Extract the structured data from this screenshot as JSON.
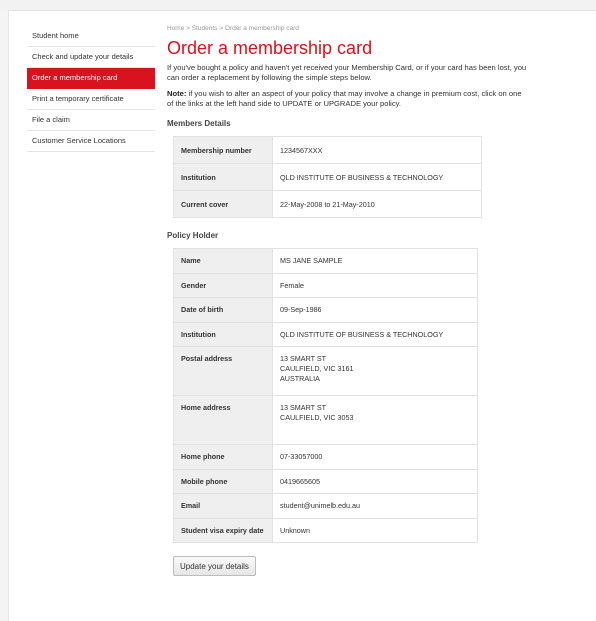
{
  "breadcrumb": {
    "home": "Home",
    "sep1": ">",
    "students": "Students",
    "sep2": ">",
    "current": "Order a membership card"
  },
  "sidebar": {
    "items": [
      {
        "label": "Student home",
        "active": false
      },
      {
        "label": "Check and update your details",
        "active": false
      },
      {
        "label": "Order a membership card",
        "active": true
      },
      {
        "label": "Print a temporary certificate",
        "active": false
      },
      {
        "label": "File a claim",
        "active": false
      },
      {
        "label": "Customer Service Locations",
        "active": false
      }
    ]
  },
  "main": {
    "title": "Order a membership card",
    "intro": "If you've bought a policy and haven't yet received your Membership Card, or if your card has been lost, you can order a replacement by following the simple steps below.",
    "note_label": "Note:",
    "note_text": " if you wish to alter an aspect of your policy that may involve a change in premium cost, click on one of the links at the left hand side to UPDATE or UPGRADE your policy."
  },
  "members": {
    "heading": "Members Details",
    "rows": [
      {
        "label": "Membership number",
        "value": "1234567XXX"
      },
      {
        "label": "Institution",
        "value": "QLD INSTITUTE OF BUSINESS & TECHNOLOGY"
      },
      {
        "label": "Current cover",
        "value": "22-May-2008 to 21-May-2010"
      }
    ]
  },
  "holder": {
    "heading": "Policy Holder",
    "rows": [
      {
        "label": "Name",
        "value": "MS JANE SAMPLE"
      },
      {
        "label": "Gender",
        "value": "Female"
      },
      {
        "label": "Date of birth",
        "value": "09-Sep-1986"
      },
      {
        "label": "Institution",
        "value": "QLD INSTITUTE OF BUSINESS & TECHNOLOGY"
      },
      {
        "label": "Postal address",
        "value": "13 SMART ST\nCAULFIELD, VIC 3161\nAUSTRALIA"
      },
      {
        "label": "Home address",
        "value": "13 SMART ST\nCAULFIELD, VIC 3053"
      },
      {
        "label": "Home phone",
        "value": "07-33057000"
      },
      {
        "label": "Mobile phone",
        "value": "0419665605"
      },
      {
        "label": "Email",
        "value": "student@unimelb.edu.au"
      },
      {
        "label": "Student visa expiry date",
        "value": "Unknown"
      }
    ]
  },
  "actions": {
    "update_label": "Update your details"
  },
  "colors": {
    "accent": "#d9121f",
    "label_bg": "#efefef",
    "border": "#e2e2e2"
  }
}
